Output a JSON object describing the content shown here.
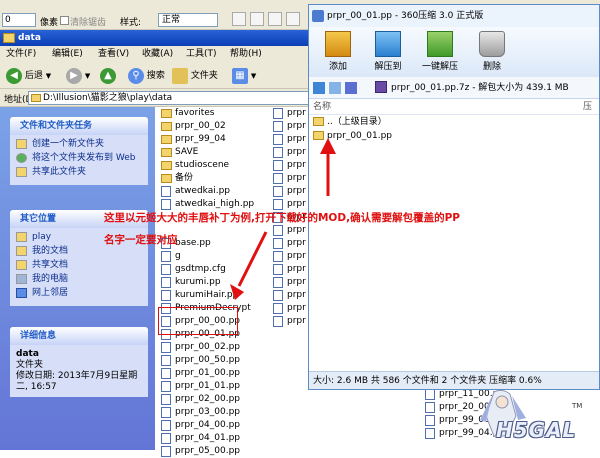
{
  "toolbar_top": {
    "pixels_value": "0",
    "pixels_unit": "像素",
    "clear_label": "清除锯齿",
    "style_label": "样式:",
    "style_value": "正常"
  },
  "explorer": {
    "title": "data",
    "menu": [
      "文件(F)",
      "编辑(E)",
      "查看(V)",
      "收藏(A)",
      "工具(T)",
      "帮助(H)"
    ],
    "nav": {
      "back": "后退",
      "search": "搜索",
      "folders": "文件夹"
    },
    "address_label": "地址(D)",
    "address_value": "D:\\Illusion\\猫影之狼\\play\\data",
    "tasks": {
      "title": "文件和文件夹任务",
      "items": [
        "创建一个新文件夹",
        "将这个文件夹发布到 Web",
        "共享此文件夹"
      ]
    },
    "places": {
      "title": "其它位置",
      "items": [
        "play",
        "我的文档",
        "共享文档",
        "我的电脑",
        "网上邻居"
      ]
    },
    "details": {
      "title": "详细信息",
      "name": "data",
      "type": "文件夹",
      "modified": "修改日期: 2013年7月9日星期二, 16:57"
    },
    "files_col1": [
      "favorites",
      "prpr_00_02",
      "prpr_99_04",
      "SAVE",
      "studioscene",
      "备份",
      "atwedkai.pp",
      "atwedkai_high.pp",
      "",
      "",
      "base.pp",
      "g",
      "gsdtmp.cfg",
      "kurumi.pp",
      "kurumiHair.pp",
      "PremiumDecrypt",
      "prpr_00_00.pp",
      "prpr_00_01.pp",
      "prpr_00_02.pp",
      "prpr_00_50.pp",
      "prpr_01_00.pp",
      "prpr_01_01.pp",
      "prpr_02_00.pp",
      "prpr_03_00.pp",
      "prpr_04_00.pp",
      "prpr_04_01.pp",
      "prpr_05_00.pp"
    ],
    "files_col2": [
      "prpr",
      "prpr",
      "prpr",
      "prpr",
      "prpr",
      "prpr",
      "prpr",
      "prpr",
      "prpr",
      "prpr",
      "prpr",
      "prpr",
      "prpr",
      "prpr",
      "prpr",
      "prpr",
      "prpr"
    ],
    "files_col3": [
      "prpr_11_00.pp",
      "prpr_20_00.pp",
      "prpr_99_00.pp",
      "prpr_99_04.pp"
    ]
  },
  "zip": {
    "title": "prpr_00_01.pp - 360压缩 3.0 正式版",
    "buttons": [
      "添加",
      "解压到",
      "一键解压",
      "删除"
    ],
    "path": "prpr_00_01.pp.7z - 解包大小为 439.1 MB",
    "col_name": "名称",
    "col_ratio": "压",
    "rows": [
      "..（上级目录）",
      "prpr_00_01.pp"
    ],
    "status": "大小: 2.6 MB 共 586 个文件和 2 个文件夹 压缩率 0.6%"
  },
  "annotation": {
    "line1": "这里以元姬大大的丰唇补丁为例,打开下载好的MOD,确认需要解包覆盖的PP",
    "line2": "名字一定要对应"
  },
  "watermark": {
    "text": "H5GAL",
    "tm": "TM"
  },
  "colors": {
    "accent": "#215dc6",
    "annotation": "#e01010",
    "xp_title": "#0a3fb5"
  }
}
